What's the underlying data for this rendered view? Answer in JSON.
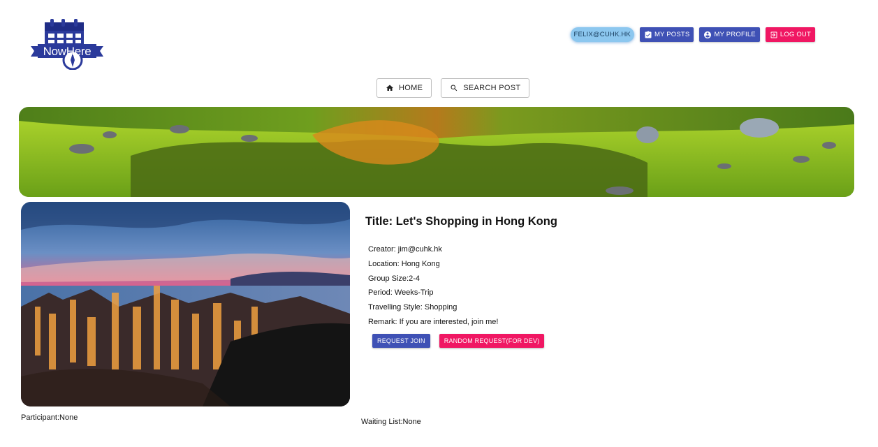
{
  "logo": {
    "text": "NowHere"
  },
  "topnav": {
    "user_email": "FELIX@CUHK.HK",
    "my_posts": "MY POSTS",
    "my_profile": "MY PROFILE",
    "log_out": "LOG OUT"
  },
  "centernav": {
    "home": "HOME",
    "search_post": "SEARCH POST"
  },
  "post": {
    "title": "Title: Let's Shopping in Hong Kong",
    "creator": "Creator: jim@cuhk.hk",
    "location": "Location: Hong Kong",
    "group_size": "Group Size:2-4",
    "period": "Period: Weeks-Trip",
    "style": "Travelling Style: Shopping",
    "remark": "Remark: If you are interested, join me!",
    "request_join": "REQUEST JOIN",
    "random_request": "RANDOM REQUEST(FOR DEV)"
  },
  "participant": "Participant:None",
  "waiting_list": "Waiting List:None",
  "colors": {
    "primary": "#3f51b5",
    "secondary": "#f01763",
    "user_chip": "#8cc7ef",
    "logo": "#2b3a9b"
  }
}
